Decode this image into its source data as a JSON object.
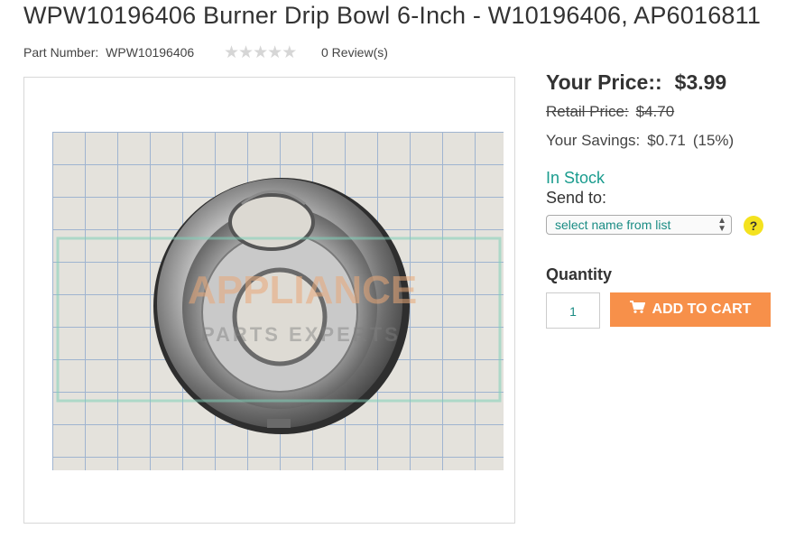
{
  "product": {
    "title": "WPW10196406 Burner Drip Bowl 6-Inch - W10196406, AP6016811",
    "part_number_label": "Part Number:",
    "part_number": "WPW10196406",
    "rating_stars": 0,
    "reviews_text": "0 Review(s)",
    "image_alt": "Burner drip bowl photo",
    "watermark_text": "APPLIANCE",
    "watermark_subtext": "PARTS EXPERTS"
  },
  "pricing": {
    "your_price_label": "Your Price::",
    "your_price": "$3.99",
    "retail_price_label": "Retail Price:",
    "retail_price": "$4.70",
    "savings_label": "Your Savings:",
    "savings": "$0.71",
    "savings_pct": "(15%)"
  },
  "stock": {
    "status": "In Stock",
    "send_to_label": "Send to:",
    "select_placeholder": "select name from list",
    "help_glyph": "?"
  },
  "purchase": {
    "quantity_label": "Quantity",
    "quantity_value": "1",
    "add_to_cart_label": "ADD TO CART"
  },
  "colors": {
    "accent_teal": "#1a9c8e",
    "cart_orange": "#f7904a",
    "help_yellow": "#f4e21f"
  },
  "icons": [
    "star-icon",
    "cart-icon",
    "help-icon",
    "select-arrows-icon"
  ]
}
